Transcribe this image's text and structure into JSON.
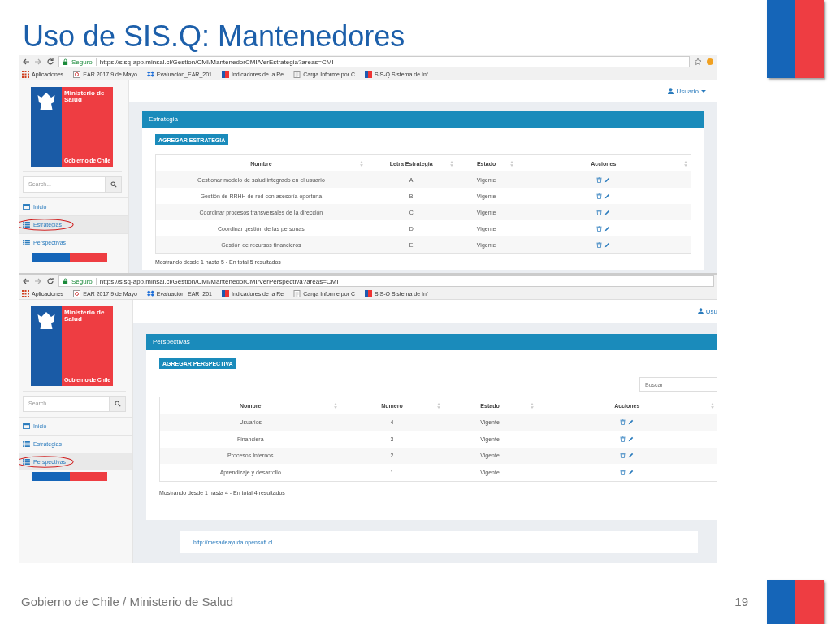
{
  "slide": {
    "title": "Uso de SIS.Q: Mantenedores",
    "footer": "Gobierno de Chile / Ministerio de Salud",
    "page_number": "19"
  },
  "screens": [
    {
      "secure_label": "Seguro",
      "url": "https://sisq-app.minsal.cl/Gestion/CMI/MantenedorCMI/VerEstrategia?areas=CMI",
      "bookmarks": [
        {
          "label": "Aplicaciones",
          "kind": "apps"
        },
        {
          "label": "EAR 2017 9 de Mayo",
          "kind": "page"
        },
        {
          "label": "Evaluación_EAR_201",
          "kind": "box"
        },
        {
          "label": "Indicadores de la Re",
          "kind": "flag"
        },
        {
          "label": "Carga Informe por C",
          "kind": "doc"
        },
        {
          "label": "SIS-Q Sistema de Inf",
          "kind": "flag"
        }
      ],
      "user_label": "Usuario",
      "user_dropdown": true,
      "logo": {
        "ministry": "Ministerio de Salud",
        "government": "Gobierno de Chile"
      },
      "search_placeholder": "Search...",
      "nav": [
        {
          "label": "Inicio",
          "kind": "home",
          "selected": false
        },
        {
          "label": "Estrategias",
          "kind": "list",
          "selected": true
        },
        {
          "label": "Perspectivas",
          "kind": "list",
          "selected": false
        }
      ],
      "panel": {
        "title": "Estrategia",
        "add_button": "AGREGAR ESTRATEGIA",
        "columns": [
          "Nombre",
          "Letra Estrategia",
          "Estado",
          "Acciones"
        ],
        "rows": [
          [
            "Gestionar modelo de salud integrado en el usuario",
            "A",
            "Vigente"
          ],
          [
            "Gestión de RRHH de red con asesoría oportuna",
            "B",
            "Vigente"
          ],
          [
            "Coordinar procesos transversales de la dirección",
            "C",
            "Vigente"
          ],
          [
            "Coordinar gestión de las personas",
            "D",
            "Vigente"
          ],
          [
            "Gestión de recursos financieros",
            "E",
            "Vigente"
          ]
        ],
        "summary": "Mostrando desde 1 hasta 5 - En total 5 resultados"
      }
    },
    {
      "secure_label": "Seguro",
      "url": "https://sisq-app.minsal.cl/Gestion/CMI/MantenedorCMI/VerPerspectiva?areas=CMI",
      "bookmarks": [
        {
          "label": "Aplicaciones",
          "kind": "apps"
        },
        {
          "label": "EAR 2017 9 de Mayo",
          "kind": "page"
        },
        {
          "label": "Evaluación_EAR_201",
          "kind": "box"
        },
        {
          "label": "Indicadores de la Re",
          "kind": "flag"
        },
        {
          "label": "Carga Informe por C",
          "kind": "doc"
        },
        {
          "label": "SIS-Q Sistema de Inf",
          "kind": "flag"
        }
      ],
      "user_label": "Usu",
      "user_dropdown": false,
      "logo": {
        "ministry": "Ministerio de Salud",
        "government": "Gobierno de Chile"
      },
      "search_placeholder": "Search...",
      "nav": [
        {
          "label": "Inicio",
          "kind": "home",
          "selected": false
        },
        {
          "label": "Estrategias",
          "kind": "list",
          "selected": false
        },
        {
          "label": "Perspectivas",
          "kind": "list",
          "selected": true
        }
      ],
      "panel": {
        "title": "Perspectivas",
        "add_button": "AGREGAR PERSPECTIVA",
        "filter_placeholder": "Buscar",
        "columns": [
          "Nombre",
          "Numero",
          "Estado",
          "Acciones"
        ],
        "rows": [
          [
            "Usuarios",
            "4",
            "Vigente"
          ],
          [
            "Financiera",
            "3",
            "Vigente"
          ],
          [
            "Procesos Internos",
            "2",
            "Vigente"
          ],
          [
            "Aprendizaje y desarrollo",
            "1",
            "Vigente"
          ]
        ],
        "summary": "Mostrando desde 1 hasta 4 - En total 4 resultados"
      },
      "footer_link": "http://mesadeayuda.opensoft.cl"
    }
  ]
}
